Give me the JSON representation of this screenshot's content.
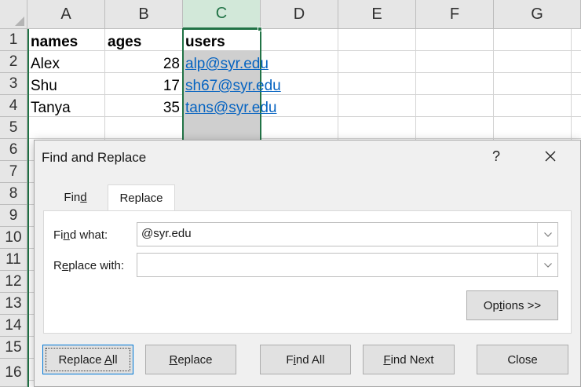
{
  "sheet": {
    "columns": [
      "A",
      "B",
      "C",
      "D",
      "E",
      "F",
      "G"
    ],
    "rows": [
      "1",
      "2",
      "3",
      "4",
      "5",
      "6",
      "7",
      "8",
      "9",
      "10",
      "11",
      "12",
      "13",
      "14",
      "15",
      "16"
    ],
    "cells": {
      "a1": "names",
      "b1": "ages",
      "c1": "users",
      "a2": "Alex",
      "b2": "28",
      "c2": "alp@syr.edu",
      "a3": "Shu",
      "b3": "17",
      "c3": "sh67@syr.edu",
      "a4": "Tanya",
      "b4": "35",
      "c4": "tans@syr.edu"
    },
    "selected_column": "C",
    "accent_color": "#217346",
    "link_color": "#0563c1"
  },
  "dialog": {
    "title": "Find and Replace",
    "help_label": "?",
    "close_icon": "close-icon",
    "tabs": {
      "find": {
        "pre": "Fin",
        "key": "d",
        "post": ""
      },
      "replace": {
        "pre": "Replace",
        "key": "",
        "post": ""
      }
    },
    "active_tab": "Replace",
    "find_what": {
      "pre": "Fi",
      "key": "n",
      "post": "d what:",
      "value": "@syr.edu"
    },
    "replace_with": {
      "pre": "R",
      "key": "e",
      "post": "place with:",
      "value": ""
    },
    "buttons": {
      "options": {
        "pre": "Op",
        "key": "t",
        "post": "ions >>"
      },
      "replace_all": {
        "pre": "Replace ",
        "key": "A",
        "post": "ll"
      },
      "replace": {
        "pre": "",
        "key": "R",
        "post": "eplace"
      },
      "find_all": {
        "pre": "F",
        "key": "i",
        "post": "nd All"
      },
      "find_next": {
        "pre": "",
        "key": "F",
        "post": "ind Next"
      },
      "close": {
        "label": "Close"
      }
    }
  }
}
